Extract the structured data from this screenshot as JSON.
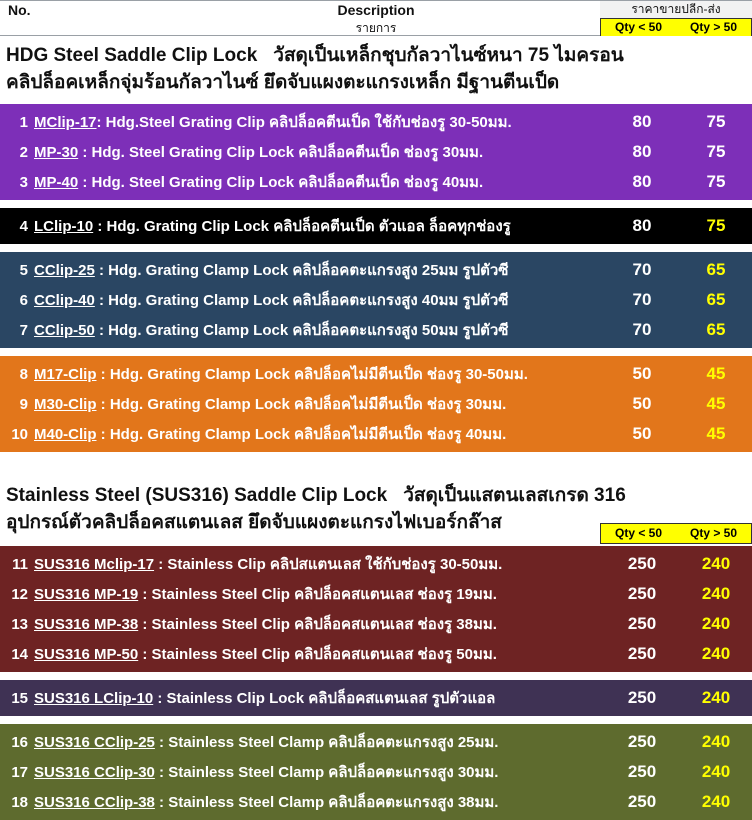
{
  "header": {
    "no_label": "No.",
    "description_label": "Description",
    "description_label_th": "รายการ",
    "price_title_th": "ราคาขายปลีก-ส่ง",
    "qty_lt_label": "Qty < 50",
    "qty_gt_label": "Qty > 50"
  },
  "section_hdg": {
    "title_en": "HDG Steel Saddle Clip Lock",
    "title_th": "วัสดุเป็นเหล็กชุบกัลวาไนซ์หนา 75 ไมครอน",
    "subtitle_th": "คลิปล็อคเหล็กจุ่มร้อนกัลวาไนซ์ ยึดจับแผงตะแกรงเหล็ก มีฐานตีนเป็ด"
  },
  "section_sus": {
    "title_en": "Stainless Steel (SUS316) Saddle Clip Lock",
    "title_th": "วัสดุเป็นแสตนเลสเกรด 316",
    "subtitle_th": "อุปกรณ์ตัวคลิปล็อคสแตนเลส ยึดจับแผงตะแกรงไฟเบอร์กล๊าส",
    "qty_lt_label": "Qty < 50",
    "qty_gt_label": "Qty > 50"
  },
  "colors": {
    "purple": "#7D2FB8",
    "black": "#000000",
    "navy": "#2A4663",
    "orange": "#E2761B",
    "maroon": "#6E2323",
    "darkpurple": "#3F3254",
    "olive": "#5E6B2E",
    "yellow": "#FFFF00",
    "white": "#FFFFFF",
    "header_yellow": "#FFFF00"
  },
  "groups": [
    {
      "bg": "#7D2FB8",
      "idx_color": "#FFFFFF",
      "desc_color": "#FFFFFF",
      "p1_color": "#FFFFFF",
      "p2_color": "#FFFFFF",
      "rows": [
        {
          "no": "1",
          "code": "MClip-17",
          "rest": ": Hdg.Steel Grating Clip คลิปล็อคตีนเป็ด ใช้กับช่องรู 30-50มม.",
          "p1": "80",
          "p2": "75"
        },
        {
          "no": "2",
          "code": "MP-30",
          "rest": " : Hdg. Steel Grating Clip Lock  คลิปล็อคตีนเป็ด ช่องรู 30มม.",
          "p1": "80",
          "p2": "75"
        },
        {
          "no": "3",
          "code": "MP-40",
          "rest": " : Hdg. Steel Grating Clip Lock  คลิปล็อคตีนเป็ด ช่องรู 40มม.",
          "p1": "80",
          "p2": "75"
        }
      ]
    },
    {
      "bg": "#000000",
      "idx_color": "#FFFFFF",
      "desc_color": "#FFFFFF",
      "p1_color": "#FFFFFF",
      "p2_color": "#FFFF00",
      "rows": [
        {
          "no": "4",
          "code": "LClip-10",
          "rest": " : Hdg. Grating Clip Lock  คลิปล็อคตีนเป็ด ตัวแอล ล็อคทุกช่องรู",
          "p1": "80",
          "p2": "75"
        }
      ]
    },
    {
      "bg": "#2A4663",
      "idx_color": "#FFFFFF",
      "desc_color": "#FFFFFF",
      "p1_color": "#FFFFFF",
      "p2_color": "#FFFF00",
      "rows": [
        {
          "no": "5",
          "code": "CClip-25",
          "rest": " : Hdg. Grating Clamp Lock  คลิปล็อคตะแกรงสูง 25มม รูปตัวซี",
          "p1": "70",
          "p2": "65"
        },
        {
          "no": "6",
          "code": "CClip-40",
          "rest": " : Hdg. Grating Clamp Lock  คลิปล็อคตะแกรงสูง 40มม รูปตัวซี",
          "p1": "70",
          "p2": "65"
        },
        {
          "no": "7",
          "code": "CClip-50",
          "rest": " : Hdg. Grating Clamp Lock  คลิปล็อคตะแกรงสูง 50มม รูปตัวซี",
          "p1": "70",
          "p2": "65"
        }
      ]
    },
    {
      "bg": "#E2761B",
      "idx_color": "#FFFFFF",
      "desc_color": "#FFFFFF",
      "p1_color": "#FFFFFF",
      "p2_color": "#FFFF00",
      "rows": [
        {
          "no": "8",
          "code": "M17-Clip",
          "rest": " : Hdg. Grating Clamp Lock  คลิปล็อคไม่มีตีนเป็ด ช่องรู 30-50มม.",
          "p1": "50",
          "p2": "45"
        },
        {
          "no": "9",
          "code": "M30-Clip",
          "rest": " : Hdg. Grating Clamp Lock  คลิปล็อคไม่มีตีนเป็ด ช่องรู 30มม.",
          "p1": "50",
          "p2": "45"
        },
        {
          "no": "10",
          "code": "M40-Clip",
          "rest": " : Hdg. Grating Clamp Lock  คลิปล็อคไม่มีตีนเป็ด ช่องรู 40มม.",
          "p1": "50",
          "p2": "45"
        }
      ]
    }
  ],
  "groups2": [
    {
      "bg": "#6E2323",
      "idx_color": "#FFFFFF",
      "desc_color": "#FFFFFF",
      "p1_color": "#FFFFFF",
      "p2_color": "#FFFF00",
      "rows": [
        {
          "no": "11",
          "code": "SUS316 Mclip-17",
          "rest": " : Stainless Clip  คลิปสแตนเลส ใช้กับช่องรู 30-50มม.",
          "p1": "250",
          "p2": "240"
        },
        {
          "no": "12",
          "code": "SUS316 MP-19",
          "rest": " : Stainless Steel  Clip  คลิปล็อคสแตนเลส ช่องรู 19มม.",
          "p1": "250",
          "p2": "240"
        },
        {
          "no": "13",
          "code": "SUS316 MP-38",
          "rest": " : Stainless Steel  Clip   คลิปล็อคสแตนเลส ช่องรู 38มม.",
          "p1": "250",
          "p2": "240"
        },
        {
          "no": "14",
          "code": "SUS316 MP-50",
          "rest": " : Stainless Steel  Clip   คลิปล็อคสแตนเลส ช่องรู 50มม.",
          "p1": "250",
          "p2": "240"
        }
      ]
    },
    {
      "bg": "#3F3254",
      "idx_color": "#FFFFFF",
      "desc_color": "#FFFFFF",
      "p1_color": "#FFFFFF",
      "p2_color": "#FFFF00",
      "rows": [
        {
          "no": "15",
          "code": "SUS316 LClip-10",
          "rest": " : Stainless  Clip Lock  คลิปล็อคสแตนเลส รูปตัวแอล",
          "p1": "250",
          "p2": "240"
        }
      ]
    },
    {
      "bg": "#5E6B2E",
      "idx_color": "#FFFFFF",
      "desc_color": "#FFFFFF",
      "p1_color": "#FFFFFF",
      "p2_color": "#FFFF00",
      "rows": [
        {
          "no": "16",
          "code": "SUS316 CClip-25",
          "rest": " : Stainless Steel Clamp  คลิปล็อคตะแกรงสูง 25มม.",
          "p1": "250",
          "p2": "240"
        },
        {
          "no": "17",
          "code": "SUS316 CClip-30",
          "rest": " : Stainless Steel Clamp  คลิปล็อคตะแกรงสูง 30มม.",
          "p1": "250",
          "p2": "240"
        },
        {
          "no": "18",
          "code": "SUS316 CClip-38",
          "rest": " : Stainless Steel Clamp  คลิปล็อคตะแกรงสูง 38มม.",
          "p1": "250",
          "p2": "240"
        }
      ]
    }
  ]
}
